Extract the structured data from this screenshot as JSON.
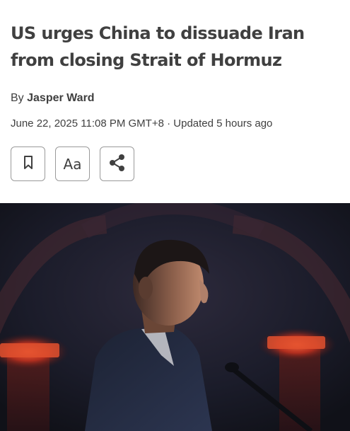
{
  "article": {
    "headline": "US urges China to dissuade Iran from closing Strait of Hormuz",
    "byline_prefix": "By",
    "author": "Jasper Ward",
    "date": "June 22, 2025 11:08 PM GMT+8",
    "separator": "·",
    "updated": "Updated 5 hours ago"
  },
  "toolbar": {
    "font_size_label": "Aa",
    "bookmark_icon": "bookmark-icon",
    "share_icon": "share-icon"
  },
  "colors": {
    "text": "#404040",
    "border": "#9a9a9a",
    "photo_background": "#1b1d2a",
    "photo_light_accent": "#e0402a"
  }
}
